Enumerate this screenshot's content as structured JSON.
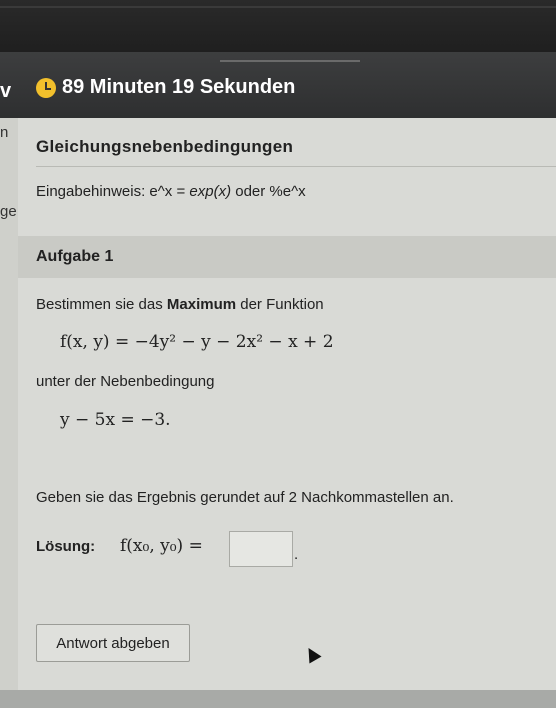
{
  "header": {
    "left_fragment": "v",
    "timer_text": "89 Minuten 19 Sekunden"
  },
  "sidebar": {
    "frag_top": "n",
    "frag_mid": "ge"
  },
  "section": {
    "title": "Gleichungsnebenbedingungen",
    "hint_prefix": "Eingabehinweis: e^x = ",
    "hint_code": "exp(x)",
    "hint_suffix": " oder %e^x"
  },
  "task": {
    "title": "Aufgabe 1",
    "intro_before": "Bestimmen sie das ",
    "intro_bold": "Maximum",
    "intro_after": " der Funktion",
    "function": "f(x, y) = −4y² − y − 2x² − x + 2",
    "constraint_intro": "unter der Nebenbedingung",
    "constraint": "y − 5x = −3.",
    "instruction": "Geben sie das Ergebnis gerundet auf 2 Nachkommastellen an."
  },
  "solution": {
    "label": "Lösung:",
    "expression": "f(x₀, y₀) =",
    "input_value": "",
    "period": "."
  },
  "actions": {
    "submit_label": "Antwort abgeben"
  },
  "icons": {
    "timer": "clock-icon",
    "cursor": "mouse-cursor-icon"
  },
  "colors": {
    "timer_icon": "#f2c02c",
    "header_bg": "#2e2f30",
    "page_bg": "#d9dad6"
  }
}
